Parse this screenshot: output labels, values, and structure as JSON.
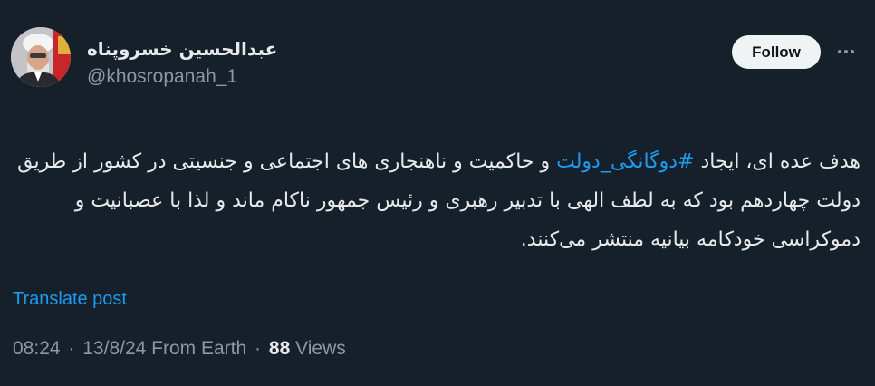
{
  "author": {
    "display_name": "عبدالحسین خسروپناه",
    "handle": "@khosropanah_1",
    "avatar_icon": "profile-photo-icon"
  },
  "actions": {
    "follow_label": "Follow",
    "more_icon": "more-options-icon"
  },
  "post": {
    "text_part1": "هدف عده ای، ایجاد ",
    "hashtag": "#دوگانگی_دولت",
    "text_part2": " و حاکمیت و  ناهنجاری های اجتماعی و جنسیتی در کشور از طریق دولت چهاردهم بود که به لطف الهی با تدبیر رهبری و رئیس جمهور ناکام ماند و لذا با عصبانیت و دموکراسی خودکامه بیانیه منتشر می‌کنند.",
    "translate_label": "Translate post"
  },
  "meta": {
    "time": "08:24",
    "separator": "·",
    "date": "13/8/24",
    "source": "From Earth",
    "views_count": "88",
    "views_label": "Views"
  },
  "colors": {
    "background": "#15202b",
    "text_primary": "#e7e9ea",
    "text_secondary": "#8b98a5",
    "accent": "#1d9bf0",
    "follow_bg": "#eff3f4"
  }
}
